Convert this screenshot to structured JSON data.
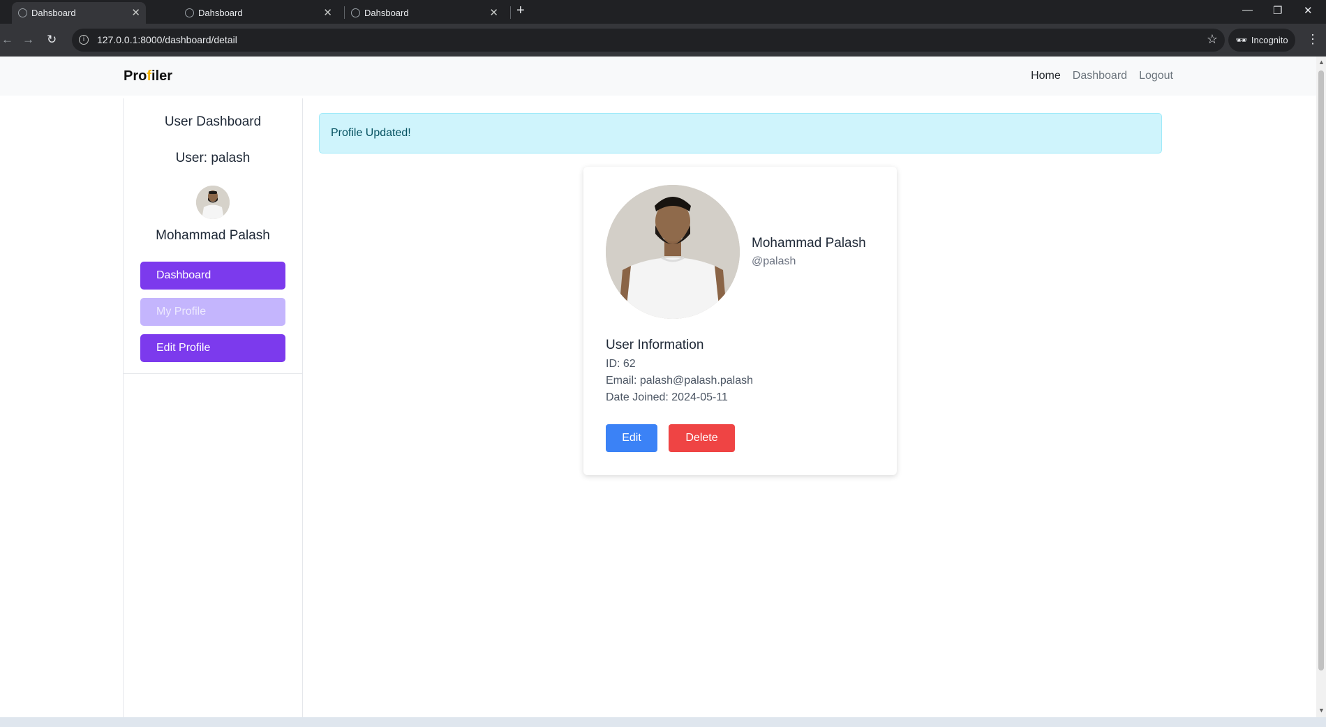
{
  "browser": {
    "tabs": [
      {
        "label": "Dahsboard",
        "active": true
      },
      {
        "label": "Dahsboard",
        "active": false
      },
      {
        "label": "Dahsboard",
        "active": false
      }
    ],
    "url": "127.0.0.1:8000/dashboard/detail",
    "incognito_label": "Incognito",
    "icons": {
      "back": "back-arrow-icon",
      "forward": "forward-arrow-icon",
      "reload": "reload-icon",
      "star": "bookmark-star-icon"
    }
  },
  "navbar": {
    "brand_prefix": "Pro",
    "brand_accent": "f",
    "brand_suffix": "iler",
    "links": [
      "Home",
      "Dashboard",
      "Logout"
    ]
  },
  "sidebar": {
    "title": "User Dashboard",
    "user_line": "User: palash",
    "full_name": "Mohammad Palash",
    "buttons": [
      "Dashboard",
      "My Profile",
      "Edit Profile"
    ]
  },
  "alert": {
    "message": "Profile Updated!"
  },
  "profile_card": {
    "name": "Mohammad Palash",
    "handle": "@palash",
    "info_title": "User Information",
    "id_line": "ID: 62",
    "email_line": "Email: palash@palash.palash",
    "joined_line": "Date Joined: 2024-05-11",
    "edit_label": "Edit",
    "delete_label": "Delete"
  },
  "colors": {
    "accent_purple": "#7c3aed",
    "muted_purple": "#c4b5fd",
    "edit_blue": "#3b82f6",
    "delete_red": "#ef4444",
    "alert_bg": "#cff4fc",
    "brand_accent": "#f5b400"
  }
}
